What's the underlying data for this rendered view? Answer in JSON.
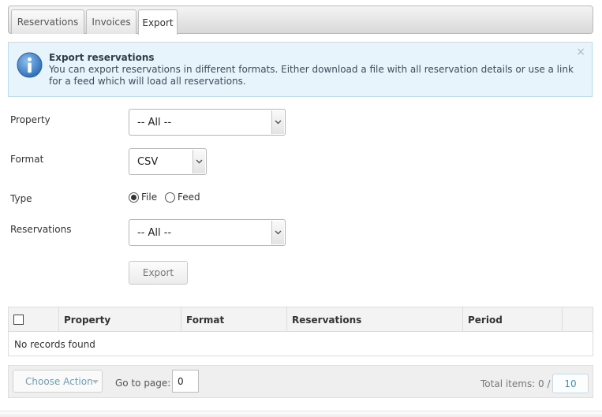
{
  "tabs": [
    {
      "label": "Reservations",
      "active": false
    },
    {
      "label": "Invoices",
      "active": false
    },
    {
      "label": "Export",
      "active": true
    }
  ],
  "alert": {
    "icon": "info-icon",
    "title": "Export reservations",
    "text": "You can export reservations in different formats. Either download a file with all reservation details or use a link for a feed which will load all reservations.",
    "close": "×"
  },
  "form": {
    "property": {
      "label": "Property",
      "value": "-- All --"
    },
    "format": {
      "label": "Format",
      "value": "CSV"
    },
    "type": {
      "label": "Type",
      "options": [
        {
          "label": "File",
          "selected": true
        },
        {
          "label": "Feed",
          "selected": false
        }
      ]
    },
    "reservations": {
      "label": "Reservations",
      "value": "-- All --"
    },
    "export_button": "Export"
  },
  "table": {
    "columns": [
      "",
      "Property",
      "Format",
      "Reservations",
      "Period",
      ""
    ],
    "empty_message": "No records found"
  },
  "footer": {
    "choose_action": "Choose Action",
    "goto_label": "Go to page:",
    "goto_value": "0",
    "total_label": "Total items: 0 /",
    "page_size": "10"
  },
  "colors": {
    "alert_bg": "#e8f4fb",
    "info_icon": "#3f7fc4",
    "link": "#4e8db0"
  }
}
